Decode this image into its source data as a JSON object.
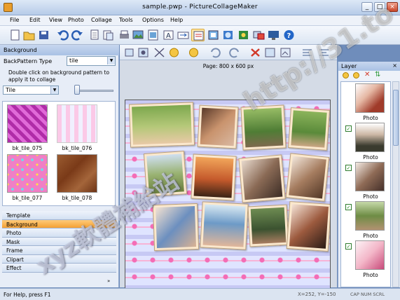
{
  "window": {
    "title": "sample.pwp - PictureCollageMaker",
    "minimize": "_",
    "restore": "□",
    "close": "×"
  },
  "menu": [
    "File",
    "Edit",
    "View",
    "Photo",
    "Collage",
    "Tools",
    "Options",
    "Help"
  ],
  "left_panel": {
    "title": "Background",
    "backpattern_label": "BackPattern Type",
    "backpattern_value": "tile",
    "description": "Double click on background pattern to apply it to collage",
    "tile_value": "Tile",
    "patterns": [
      {
        "label": "bk_tile_075",
        "colors": [
          "#b02ca8",
          "#e06ad8"
        ]
      },
      {
        "label": "bk_tile_076",
        "colors": [
          "#fbc9e7",
          "#f0f0ff"
        ]
      },
      {
        "label": "bk_tile_077",
        "colors": [
          "#f07fc5",
          "#ffde48"
        ]
      },
      {
        "label": "bk_tile_078",
        "colors": [
          "#9a5b30",
          "#6d3416"
        ]
      }
    ],
    "nav": [
      "Template",
      "Background",
      "Photo",
      "Mask",
      "Frame",
      "Clipart",
      "Effect"
    ],
    "active_nav": "Background",
    "more": "»"
  },
  "center": {
    "page_size": "Page: 800 x 600 px"
  },
  "layer_panel": {
    "title": "Layer",
    "close": "×",
    "items": [
      {
        "label": "Photo"
      },
      {
        "label": "Photo"
      },
      {
        "label": "Photo"
      },
      {
        "label": "Photo"
      },
      {
        "label": "Photo"
      }
    ]
  },
  "status": {
    "text": "For Help, press F1",
    "coords": "X=252, Y=-150",
    "indicators": "CAP NUM SCRL"
  },
  "watermark": {
    "url": "http://31.to",
    "cjk": "xyz軟體補給站"
  },
  "colors": {
    "accent": "#f4a033",
    "canvas_pink": "#f46cb6",
    "frame": "#fbe8cd"
  }
}
